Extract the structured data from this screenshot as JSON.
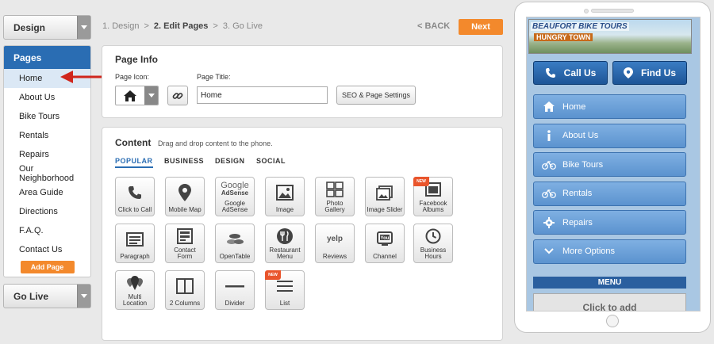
{
  "left": {
    "design_dropdown": "Design",
    "pages_header": "Pages",
    "pages": [
      "Home",
      "About Us",
      "Bike Tours",
      "Rentals",
      "Repairs",
      "Our Neighborhood",
      "Area Guide",
      "Directions",
      "F.A.Q.",
      "Contact Us"
    ],
    "active_page_index": 0,
    "add_page_label": "Add Page",
    "golive_dropdown": "Go Live"
  },
  "breadcrumb": {
    "step1": "1. Design",
    "sep1": ">",
    "step2": "2. Edit Pages",
    "sep2": ">",
    "step3": "3. Go Live",
    "back_label": "< BACK",
    "next_label": "Next"
  },
  "page_info": {
    "title": "Page Info",
    "icon_label": "Page Icon:",
    "title_label": "Page Title:",
    "title_value": "Home",
    "seo_button": "SEO & Page Settings"
  },
  "content": {
    "title": "Content",
    "subtitle": "Drag and drop content to the phone.",
    "tabs": [
      "POPULAR",
      "BUSINESS",
      "DESIGN",
      "SOCIAL"
    ],
    "active_tab_index": 0,
    "widgets": [
      {
        "label": "Click to Call",
        "icon": "phone-icon"
      },
      {
        "label": "Mobile Map",
        "icon": "map-pin-icon"
      },
      {
        "label": "Google AdSense",
        "icon": "google-adsense-icon",
        "logo_text": "Google",
        "logo_sub": "AdSense"
      },
      {
        "label": "Image",
        "icon": "image-icon"
      },
      {
        "label": "Photo Gallery",
        "icon": "photo-gallery-icon"
      },
      {
        "label": "Image Slider",
        "icon": "image-slider-icon"
      },
      {
        "label": "Facebook Albums",
        "icon": "facebook-albums-icon",
        "badge": "NEW"
      },
      {
        "label": "Paragraph",
        "icon": "paragraph-icon"
      },
      {
        "label": "Contact Form",
        "icon": "contact-form-icon"
      },
      {
        "label": "OpenTable",
        "icon": "opentable-icon"
      },
      {
        "label": "Restaurant Menu",
        "icon": "restaurant-menu-icon"
      },
      {
        "label": "Reviews",
        "icon": "yelp-icon",
        "logo_text": "yelp"
      },
      {
        "label": "Channel",
        "icon": "youtube-channel-icon",
        "logo_text": "You"
      },
      {
        "label": "Business Hours",
        "icon": "clock-icon"
      },
      {
        "label": "Multi Location",
        "icon": "multi-location-icon"
      },
      {
        "label": "2 Columns",
        "icon": "two-columns-icon"
      },
      {
        "label": "Divider",
        "icon": "divider-icon"
      },
      {
        "label": "List",
        "icon": "list-icon",
        "badge": "NEW"
      }
    ]
  },
  "phone": {
    "banner_title": "BEAUFORT BIKE TOURS",
    "banner_sub": "HUNGRY TOWN",
    "cta_call": "Call Us",
    "cta_find": "Find Us",
    "menu_items": [
      {
        "label": "Home",
        "icon": "home-icon"
      },
      {
        "label": "About Us",
        "icon": "info-icon"
      },
      {
        "label": "Bike Tours",
        "icon": "bicycle-icon"
      },
      {
        "label": "Rentals",
        "icon": "bicycle-icon"
      },
      {
        "label": "Repairs",
        "icon": "gear-icon"
      },
      {
        "label": "More Options",
        "icon": "chevron-down-icon"
      }
    ],
    "menu_header": "MENU",
    "click_to_add": "Click to add"
  },
  "colors": {
    "accent_blue": "#2a6db3",
    "accent_orange": "#f3892c",
    "new_badge": "#e9552c",
    "arrow_red": "#d0261c"
  }
}
